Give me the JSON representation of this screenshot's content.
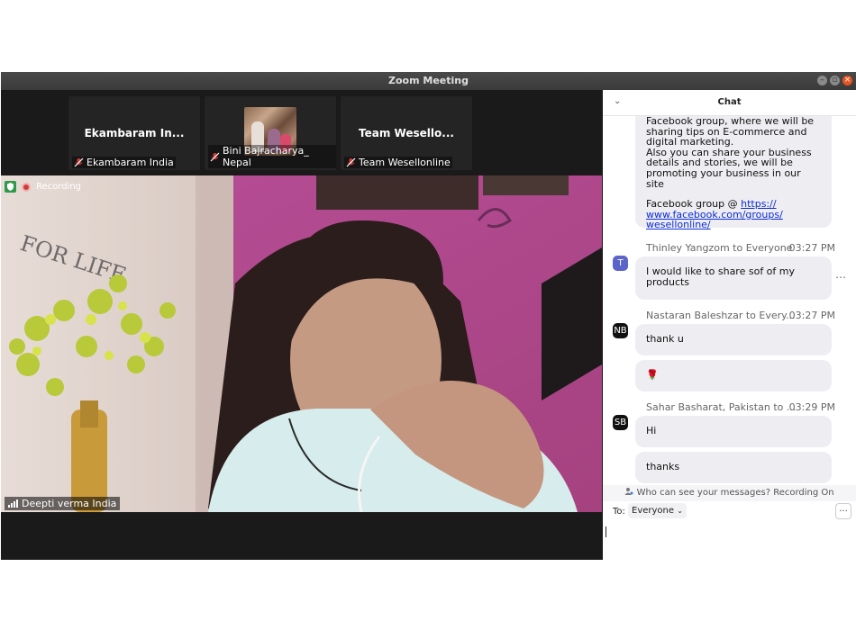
{
  "window": {
    "title": "Zoom Meeting"
  },
  "thumbnails": [
    {
      "center_name": "Ekambaram In...",
      "label": "Ekambaram India",
      "has_photo": false
    },
    {
      "center_name": "",
      "label": "Bini Bajracharya_ Nepal",
      "has_photo": true
    },
    {
      "center_name": "Team Wesello...",
      "label": "Team Wesellonline",
      "has_photo": false
    }
  ],
  "main_video": {
    "recording_label": "Recording",
    "participant_label": "Deepti verma India",
    "wall_text": "FOR LIFE"
  },
  "chat": {
    "title": "Chat",
    "collapse_icon": "chevron-down-icon",
    "first_message": {
      "line1": "Facebook group, where we will be",
      "line2": "sharing tips on E-commerce and",
      "line3": "digital marketing.",
      "line4": "Also you can share your business",
      "line5": "details and stories, we will be",
      "line6": "promoting your business in our site",
      "line7": "Facebook group @ ",
      "link1": "https://",
      "link2": "www.facebook.com/groups/",
      "link3": "wesellonline/"
    },
    "groups": [
      {
        "sender": "Thinley Yangzom to Everyone",
        "time": "03:27 PM",
        "avatar": "T",
        "avatar_color": "#5b64c8",
        "messages": [
          "I would like to share sof of my",
          "products"
        ]
      },
      {
        "sender": "Nastaran Baleshzar to Every...",
        "time": "03:27 PM",
        "avatar": "NB",
        "avatar_color": "#111111",
        "messages": [
          "thank u",
          "🌹"
        ]
      },
      {
        "sender": "Sahar Basharat, Pakistan to ...",
        "time": "03:29 PM",
        "avatar": "SB",
        "avatar_color": "#111111",
        "messages": [
          "Hi",
          "thanks"
        ]
      }
    ],
    "visibility_note": "Who can see your messages? Recording On",
    "to_label": "To:",
    "recipient": "Everyone",
    "more": "..."
  },
  "colors": {
    "titlebar": "#3d3d3d",
    "video_bg": "#1a1a1a",
    "bubble": "#eeeef2",
    "link": "#0c2bd6",
    "recording": "#d23b3b"
  }
}
